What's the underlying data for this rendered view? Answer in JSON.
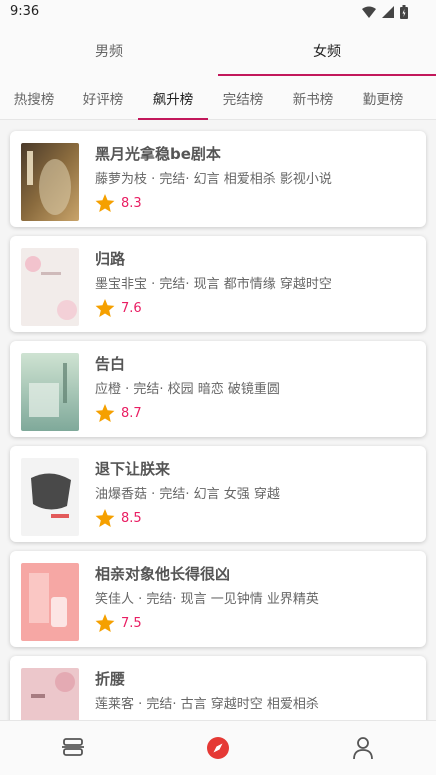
{
  "status_bar": {
    "time": "9:36"
  },
  "gender_tabs": [
    {
      "label": "男频",
      "active": false
    },
    {
      "label": "女频",
      "active": true
    }
  ],
  "rank_tabs": [
    {
      "label": "热搜榜",
      "active": false
    },
    {
      "label": "好评榜",
      "active": false
    },
    {
      "label": "飙升榜",
      "active": true
    },
    {
      "label": "完结榜",
      "active": false
    },
    {
      "label": "新书榜",
      "active": false
    },
    {
      "label": "勤更榜",
      "active": false
    }
  ],
  "books": [
    {
      "title": "黑月光拿稳be剧本",
      "meta": "藤萝为枝 · 完结· 幻言 相爱相杀 影视小说",
      "rating": "8.3"
    },
    {
      "title": "归路",
      "meta": "墨宝非宝 · 完结· 现言 都市情缘 穿越时空",
      "rating": "7.6"
    },
    {
      "title": "告白",
      "meta": "应橙 · 完结· 校园 暗恋 破镜重圆",
      "rating": "8.7"
    },
    {
      "title": "退下让朕来",
      "meta": "油爆香菇 · 完结· 幻言 女强 穿越",
      "rating": "8.5"
    },
    {
      "title": "相亲对象他长得很凶",
      "meta": "笑佳人 · 完结· 现言 一见钟情 业界精英",
      "rating": "7.5"
    },
    {
      "title": "折腰",
      "meta": "莲莱客 · 完结· 古言 穿越时空 相爱相杀",
      "rating": ""
    }
  ],
  "colors": {
    "accent": "#c2185b",
    "rating": "#e91e63",
    "star": "#f5a000"
  },
  "icons": {
    "nav": [
      "bookshelf-icon",
      "compass-icon",
      "user-icon"
    ]
  }
}
